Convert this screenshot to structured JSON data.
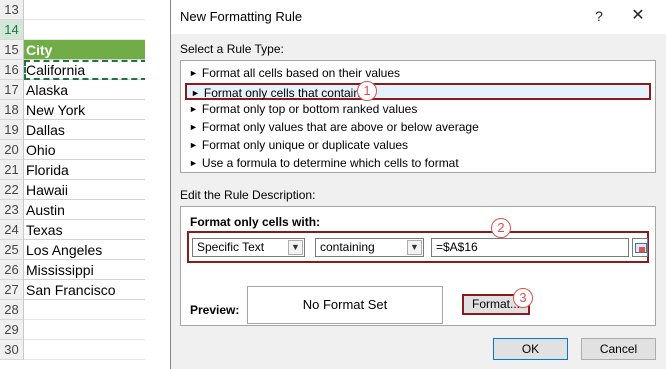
{
  "sheet": {
    "rows": [
      {
        "num": "13",
        "value": "",
        "kind": "empty"
      },
      {
        "num": "14",
        "value": "",
        "kind": "empty",
        "selected": true
      },
      {
        "num": "15",
        "value": "City",
        "kind": "header"
      },
      {
        "num": "16",
        "value": "California",
        "kind": "active"
      },
      {
        "num": "17",
        "value": "Alaska",
        "kind": "data"
      },
      {
        "num": "18",
        "value": "New York",
        "kind": "data"
      },
      {
        "num": "19",
        "value": "Dallas",
        "kind": "data"
      },
      {
        "num": "20",
        "value": "Ohio",
        "kind": "data"
      },
      {
        "num": "21",
        "value": "Florida",
        "kind": "data"
      },
      {
        "num": "22",
        "value": "Hawaii",
        "kind": "data"
      },
      {
        "num": "23",
        "value": "Austin",
        "kind": "data"
      },
      {
        "num": "24",
        "value": "Texas",
        "kind": "data"
      },
      {
        "num": "25",
        "value": "Los Angeles",
        "kind": "data"
      },
      {
        "num": "26",
        "value": "Mississippi",
        "kind": "data"
      },
      {
        "num": "27",
        "value": "San Francisco",
        "kind": "data"
      },
      {
        "num": "28",
        "value": "",
        "kind": "empty"
      },
      {
        "num": "29",
        "value": "",
        "kind": "empty"
      },
      {
        "num": "30",
        "value": "",
        "kind": "empty"
      }
    ]
  },
  "dialog": {
    "title": "New Formatting Rule",
    "help": "?",
    "close": "✕",
    "select_rule_label": "Select a Rule Type:",
    "rule_types": [
      "Format all cells based on their values",
      "Format only cells that contain",
      "Format only top or bottom ranked values",
      "Format only values that are above or below average",
      "Format only unique or duplicate values",
      "Use a formula to determine which cells to format"
    ],
    "selected_rule_index": 1,
    "edit_label": "Edit the Rule Description:",
    "format_cells_with_label": "Format only cells with:",
    "condition_type": "Specific Text",
    "operator": "containing",
    "value": "=$A$16",
    "preview_label": "Preview:",
    "preview_text": "No Format Set",
    "format_button": "Format...",
    "ok_button": "OK",
    "cancel_button": "Cancel"
  },
  "callouts": [
    "1",
    "2",
    "3"
  ],
  "colors": {
    "header_fill": "#70ad47",
    "highlight_border": "#8b1a1a",
    "callout": "#d9534f"
  }
}
